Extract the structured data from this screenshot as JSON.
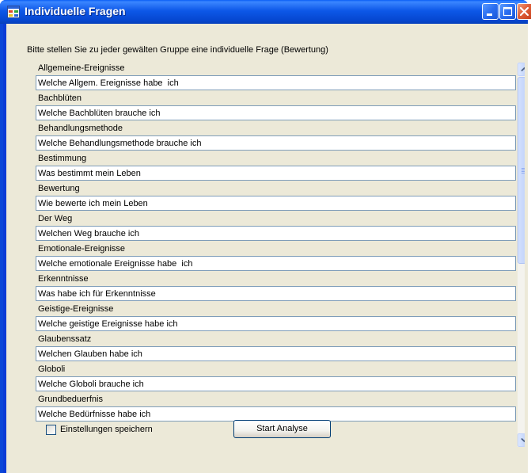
{
  "window": {
    "title": "Individuelle Fragen",
    "prompt": "Bitte stellen Sie zu jeder gewälten Gruppe eine individuelle Frage (Bewertung)"
  },
  "groups": [
    {
      "label": "Allgemeine-Ereignisse",
      "question": "Welche Allgem. Ereignisse habe  ich"
    },
    {
      "label": "Bachblüten",
      "question": "Welche Bachblüten brauche ich"
    },
    {
      "label": "Behandlungsmethode",
      "question": "Welche Behandlungsmethode brauche ich"
    },
    {
      "label": "Bestimmung",
      "question": "Was bestimmt mein Leben"
    },
    {
      "label": "Bewertung",
      "question": "Wie bewerte ich mein Leben"
    },
    {
      "label": "Der Weg",
      "question": "Welchen Weg brauche ich"
    },
    {
      "label": "Emotionale-Ereignisse",
      "question": "Welche emotionale Ereignisse habe  ich"
    },
    {
      "label": "Erkenntnisse",
      "question": "Was habe ich für Erkenntnisse"
    },
    {
      "label": "Geistige-Ereignisse",
      "question": "Welche geistige Ereignisse habe ich"
    },
    {
      "label": "Glaubenssatz",
      "question": "Welchen Glauben habe ich"
    },
    {
      "label": "Globoli",
      "question": "Welche Globoli brauche ich"
    },
    {
      "label": "Grundbeduerfnis",
      "question": "Welche Bedürfnisse habe ich"
    }
  ],
  "footer": {
    "checkbox_label": "Einstellungen speichern",
    "checkbox_checked": false,
    "button_label": "Start Analyse"
  },
  "scroll": {
    "position_fraction": 0.0,
    "visible_fraction": 0.52
  },
  "colors": {
    "titlebar": "#0a5ff6",
    "client_bg": "#ece9d8",
    "input_border": "#7f9db9",
    "close_button": "#e0603a"
  }
}
